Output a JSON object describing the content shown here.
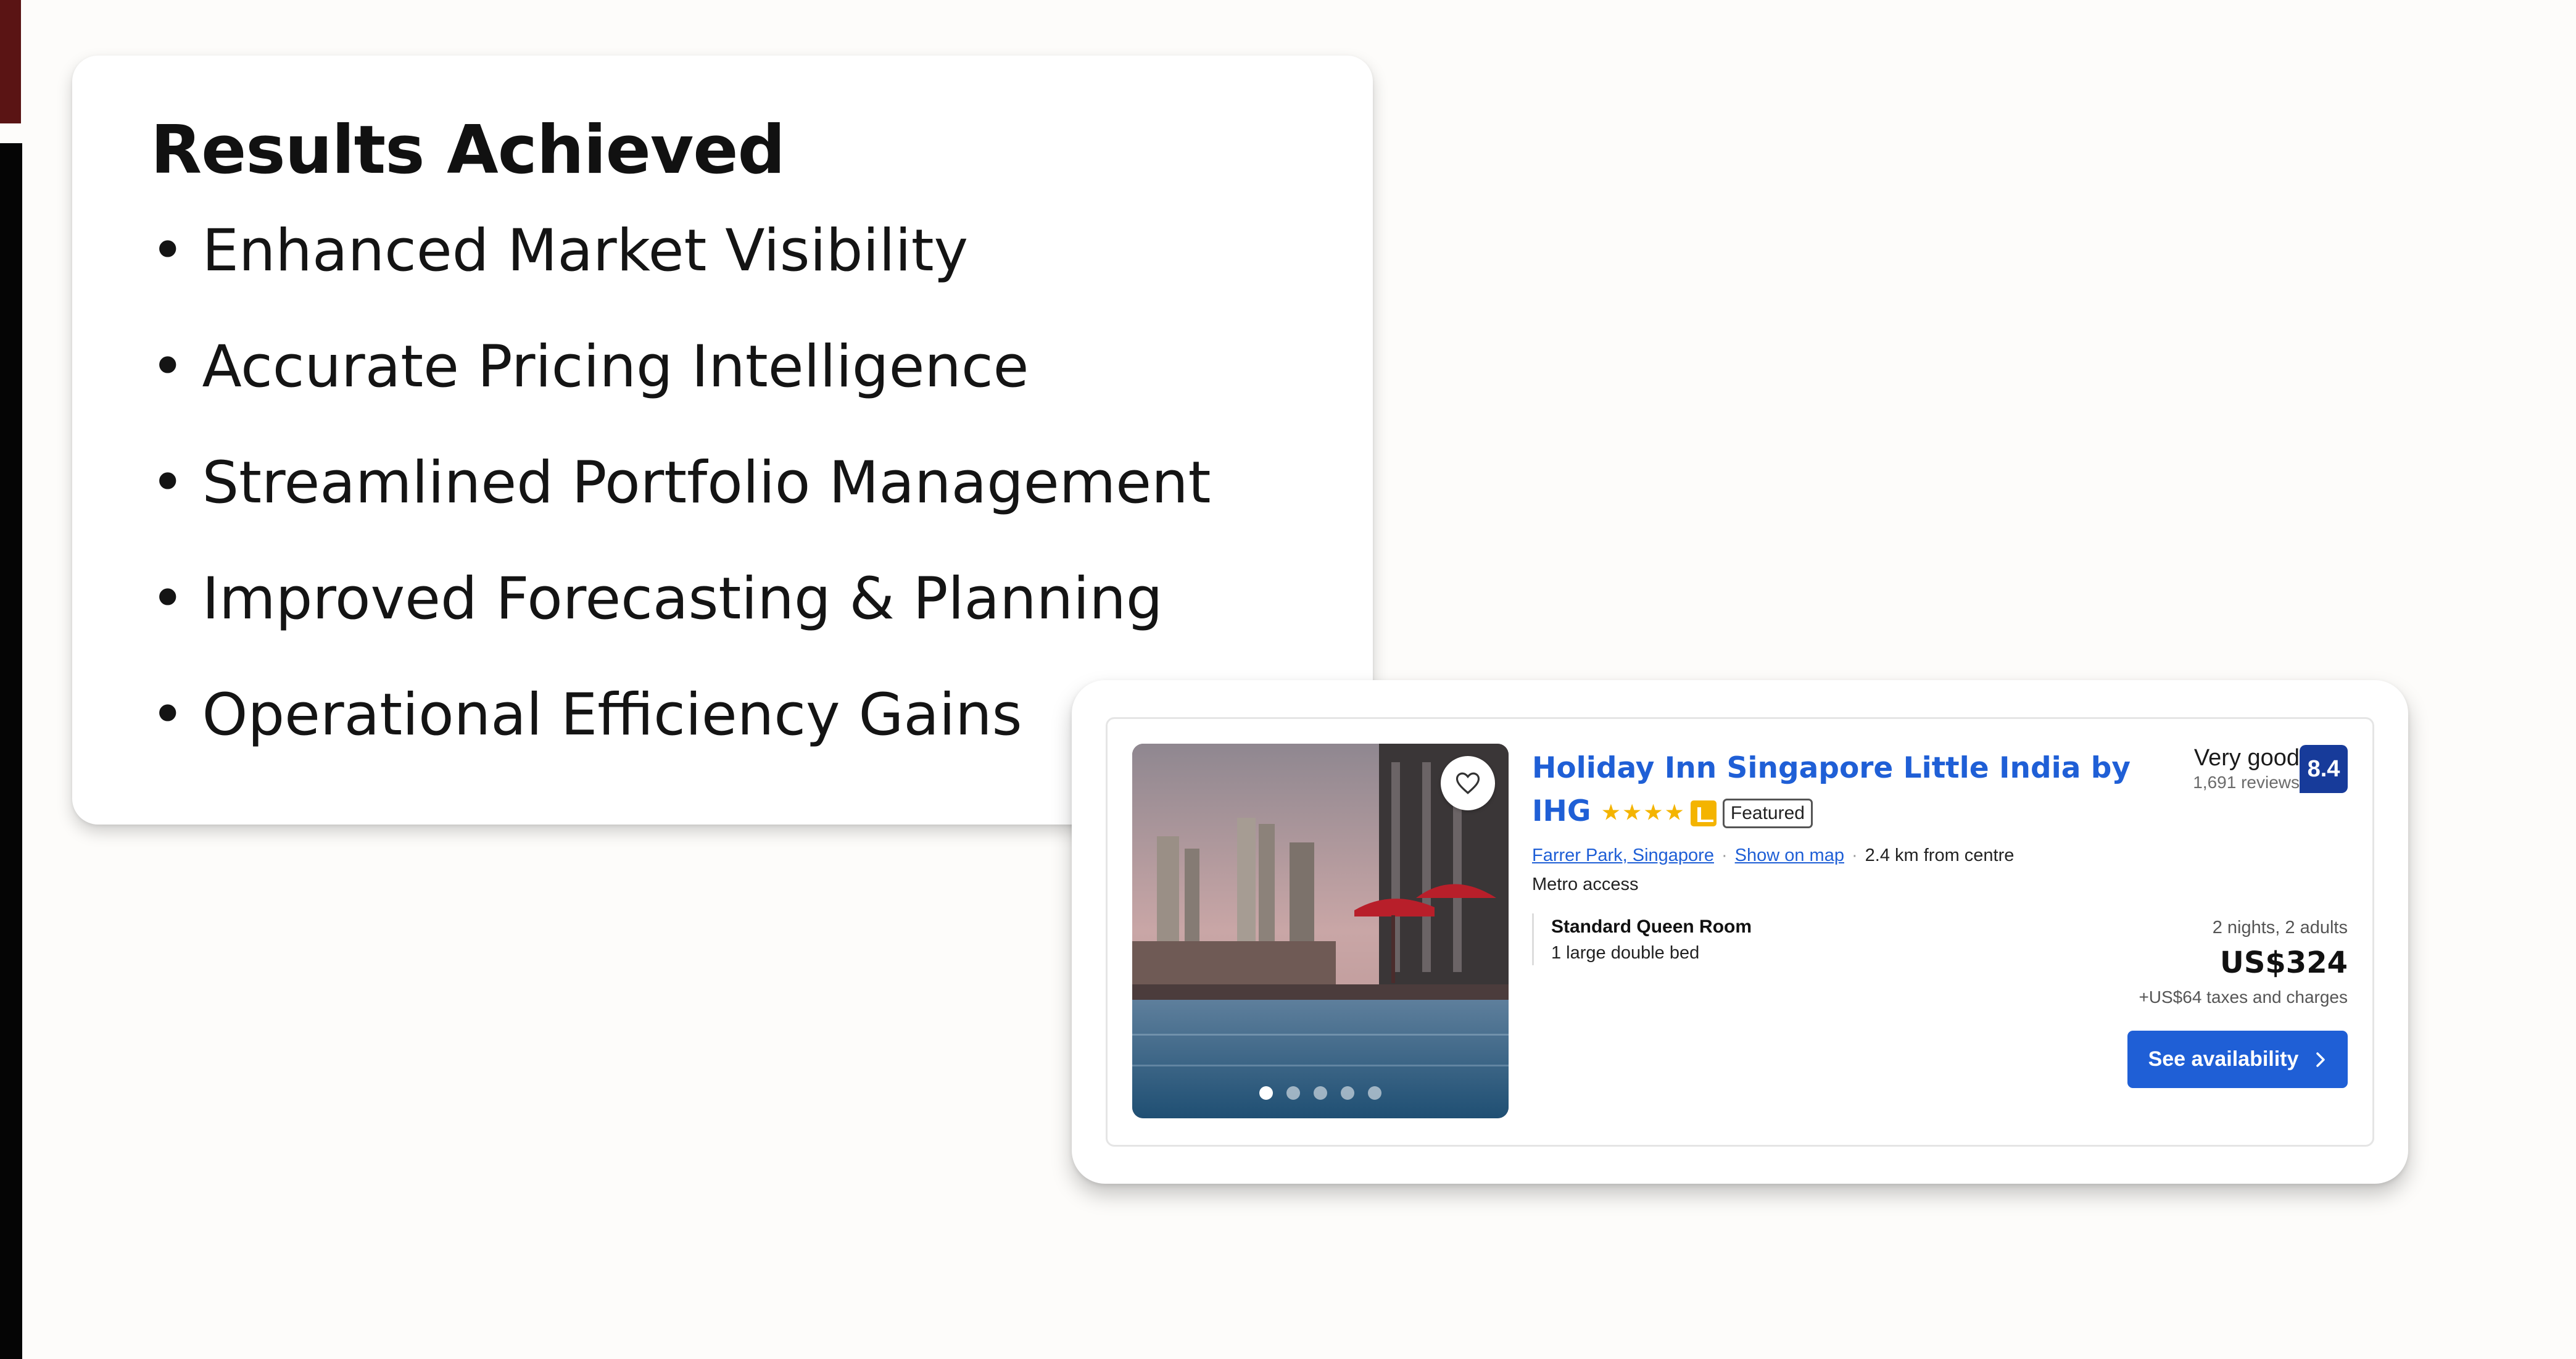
{
  "results": {
    "title": "Results Achieved",
    "bullet": "•",
    "items": [
      "Enhanced Market Visibility",
      "Accurate Pricing Intelligence",
      "Streamlined Portfolio Management",
      "Improved Forecasting & Planning",
      "Operational Efficiency Gains"
    ]
  },
  "listing": {
    "name_line1": "Holiday Inn Singapore Little India by",
    "name_line2": "IHG",
    "star_count": 4,
    "stars": "★★★★",
    "featured_label": "Featured",
    "location_link": "Farrer Park, Singapore",
    "map_link": "Show on map",
    "distance": "2.4 km from centre",
    "amenity": "Metro access",
    "room_name": "Standard Queen Room",
    "bed": "1 large double bed",
    "rating_word": "Very good",
    "review_count": "1,691 reviews",
    "score": "8.4",
    "stay": "2 nights, 2 adults",
    "price": "US$324",
    "taxes": "+US$64 taxes and charges",
    "cta": "See availability",
    "photo_count": 5,
    "active_photo": 1,
    "colors": {
      "link_blue": "#1f5fd6",
      "score_navy": "#173b9a",
      "star_gold": "#f4b400"
    }
  }
}
